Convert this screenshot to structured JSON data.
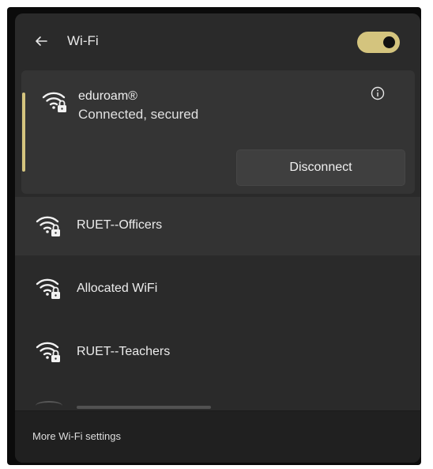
{
  "header": {
    "title": "Wi-Fi",
    "back_icon": "back-arrow-icon",
    "toggle_state": "on"
  },
  "connected": {
    "name": "eduroam®",
    "status": "Connected, secured",
    "disconnect_label": "Disconnect",
    "icon": "wifi-secured-icon",
    "info_icon": "info-icon"
  },
  "networks": [
    {
      "label": "RUET--Officers",
      "icon": "wifi-secured-icon"
    },
    {
      "label": "Allocated WiFi",
      "icon": "wifi-secured-icon"
    },
    {
      "label": "RUET--Teachers",
      "icon": "wifi-secured-icon"
    }
  ],
  "footer": {
    "settings_label": "More Wi-Fi settings"
  },
  "colors": {
    "accent": "#d4c47e",
    "panel": "#2a2a2a",
    "card": "#343434"
  }
}
